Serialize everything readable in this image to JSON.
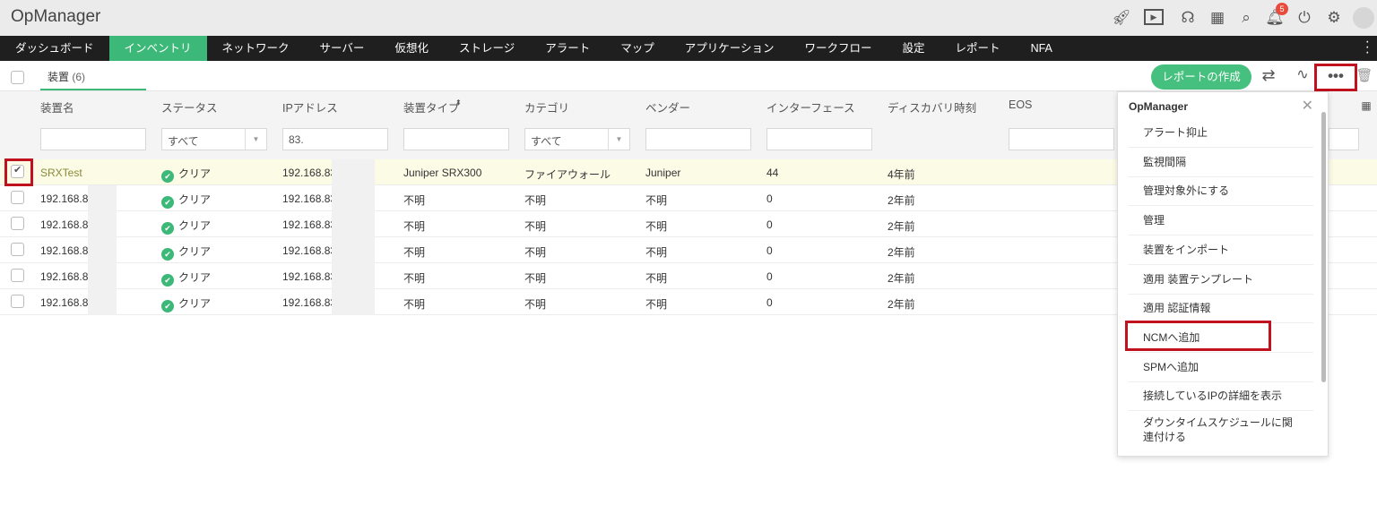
{
  "app": {
    "title": "OpManager",
    "notification_count": "5"
  },
  "nav": [
    "ダッシュボード",
    "インベントリ",
    "ネットワーク",
    "サーバー",
    "仮想化",
    "ストレージ",
    "アラート",
    "マップ",
    "アプリケーション",
    "ワークフロー",
    "設定",
    "レポート",
    "NFA"
  ],
  "toolbar": {
    "tab_label": "装置",
    "tab_count": "(6)",
    "report_button": "レポートの作成"
  },
  "table": {
    "headers": [
      "装置名",
      "ステータス",
      "IPアドレス",
      "装置タイプ",
      "カテゴリ",
      "ベンダー",
      "インターフェース",
      "ディスカバリ時刻",
      "EOS"
    ],
    "filters": {
      "status": "すべて",
      "ip": "83.",
      "category": "すべて"
    },
    "rows": [
      {
        "name": "SRXTest",
        "status": "クリア",
        "ip": "192.168.83.",
        "type": "Juniper SRX300",
        "category": "ファイアウォール",
        "vendor": "Juniper",
        "interfaces": "44",
        "discovered": "4年前",
        "checked": true
      },
      {
        "name": "192.168.83",
        "status": "クリア",
        "ip": "192.168.83.",
        "type": "不明",
        "category": "不明",
        "vendor": "不明",
        "interfaces": "0",
        "discovered": "2年前",
        "checked": false
      },
      {
        "name": "192.168.83",
        "status": "クリア",
        "ip": "192.168.83.",
        "type": "不明",
        "category": "不明",
        "vendor": "不明",
        "interfaces": "0",
        "discovered": "2年前",
        "checked": false
      },
      {
        "name": "192.168.83",
        "status": "クリア",
        "ip": "192.168.83.",
        "type": "不明",
        "category": "不明",
        "vendor": "不明",
        "interfaces": "0",
        "discovered": "2年前",
        "checked": false
      },
      {
        "name": "192.168.83",
        "status": "クリア",
        "ip": "192.168.83.",
        "type": "不明",
        "category": "不明",
        "vendor": "不明",
        "interfaces": "0",
        "discovered": "2年前",
        "checked": false
      },
      {
        "name": "192.168.83",
        "status": "クリア",
        "ip": "192.168.83.",
        "type": "不明",
        "category": "不明",
        "vendor": "不明",
        "interfaces": "0",
        "discovered": "2年前",
        "checked": false
      }
    ]
  },
  "menu": {
    "title": "OpManager",
    "items": [
      "アラート抑止",
      "監視間隔",
      "管理対象外にする",
      "管理",
      "装置をインポート",
      "適用 装置テンプレート",
      "適用 認証情報",
      "NCMへ追加",
      "SPMへ追加",
      "接続しているIPの詳細を表示",
      "ダウンタイムスケジュールに関連付ける"
    ]
  }
}
